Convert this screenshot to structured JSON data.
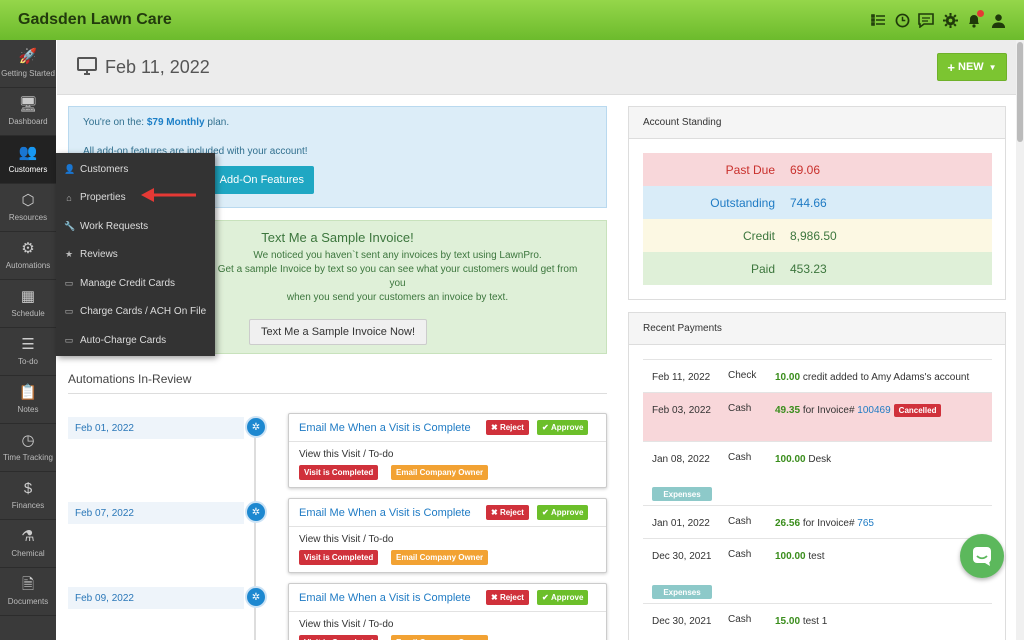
{
  "app": {
    "title": "Gadsden Lawn Care",
    "icons": [
      "checklist-icon",
      "clock-icon",
      "message-icon",
      "gear-icon",
      "bell-icon",
      "user-icon"
    ]
  },
  "sidebar": {
    "items": [
      {
        "label": "Getting Started",
        "icon": "rocket-icon"
      },
      {
        "label": "Dashboard",
        "icon": "monitor-icon"
      },
      {
        "label": "Customers",
        "icon": "users-icon",
        "active": true
      },
      {
        "label": "Resources",
        "icon": "box-icon"
      },
      {
        "label": "Automations",
        "icon": "cogs-icon"
      },
      {
        "label": "Schedule",
        "icon": "calendar-icon"
      },
      {
        "label": "To-do",
        "icon": "list-icon"
      },
      {
        "label": "Notes",
        "icon": "clipboard-icon"
      },
      {
        "label": "Time Tracking",
        "icon": "clock-icon"
      },
      {
        "label": "Finances",
        "icon": "dollar-icon"
      },
      {
        "label": "Chemical",
        "icon": "flask-icon"
      },
      {
        "label": "Documents",
        "icon": "document-icon"
      }
    ]
  },
  "header": {
    "date": "Feb 11, 2022",
    "new_label": "NEW"
  },
  "plan": {
    "prefix": "You're on the:",
    "plan": "$79 Monthly",
    "suffix": "plan.",
    "addons": "All add-on features are included with your account!",
    "addon_btn": "Add-On Features"
  },
  "textme": {
    "title": "Text Me a Sample Invoice!",
    "line1": "We noticed you haven`t sent any invoices by text using LawnPro.",
    "line2": "Get a sample Invoice by text so you can see what your customers would get from you",
    "line3": "when you send your customers an invoice by text.",
    "button": "Text Me a Sample Invoice Now!"
  },
  "menu": {
    "items": [
      "Customers",
      "Properties",
      "Work Requests",
      "Reviews",
      "Manage Credit Cards",
      "Charge Cards / ACH On File",
      "Auto-Charge Cards"
    ]
  },
  "automations": {
    "title": "Automations In-Review",
    "rows": [
      {
        "date": "Feb 01, 2022",
        "title": "Email Me When a Visit is Complete",
        "sub": "View this Visit / To-do",
        "reject": "Reject",
        "approve": "Approve",
        "tag1": "Visit is Completed",
        "tag2": "Email Company Owner"
      },
      {
        "date": "Feb 07, 2022",
        "title": "Email Me When a Visit is Complete",
        "sub": "View this Visit / To-do",
        "reject": "Reject",
        "approve": "Approve",
        "tag1": "Visit is Completed",
        "tag2": "Email Company Owner"
      },
      {
        "date": "Feb 09, 2022",
        "title": "Email Me When a Visit is Complete",
        "sub": "View this Visit / To-do",
        "reject": "Reject",
        "approve": "Approve",
        "tag1": "Visit is Completed",
        "tag2": "Email Company Owner"
      }
    ]
  },
  "standing": {
    "title": "Account Standing",
    "rows": [
      {
        "label": "Past Due",
        "value": "69.06",
        "bg": "#f8d7da",
        "color": "#c9302c"
      },
      {
        "label": "Outstanding",
        "value": "744.66",
        "bg": "#d9ecf8",
        "color": "#1f7bc4"
      },
      {
        "label": "Credit",
        "value": "8,986.50",
        "bg": "#fcf8e3",
        "color": "#3c763d"
      },
      {
        "label": "Paid",
        "value": "453.23",
        "bg": "#dff0d8",
        "color": "#3c763d"
      }
    ]
  },
  "payments": {
    "title": "Recent Payments",
    "rows": [
      {
        "date": "Feb 11, 2022",
        "method": "Check",
        "amount": "10.00",
        "text": "credit added to Amy Adams's account"
      },
      {
        "date": "Feb 03, 2022",
        "method": "Cash",
        "amount": "49.35",
        "text": "for Invoice#",
        "link": "100469",
        "badge": "Cancelled"
      },
      {
        "date": "Jan 08, 2022",
        "method": "Cash",
        "amount": "100.00",
        "text": "Desk",
        "tag": "Expenses"
      },
      {
        "date": "Jan 01, 2022",
        "method": "Cash",
        "amount": "26.56",
        "text": "for Invoice#",
        "link": "765"
      },
      {
        "date": "Dec 30, 2021",
        "method": "Cash",
        "amount": "100.00",
        "text": "test",
        "tag": "Expenses"
      },
      {
        "date": "Dec 30, 2021",
        "method": "Cash",
        "amount": "15.00",
        "text": "test 1"
      }
    ]
  }
}
